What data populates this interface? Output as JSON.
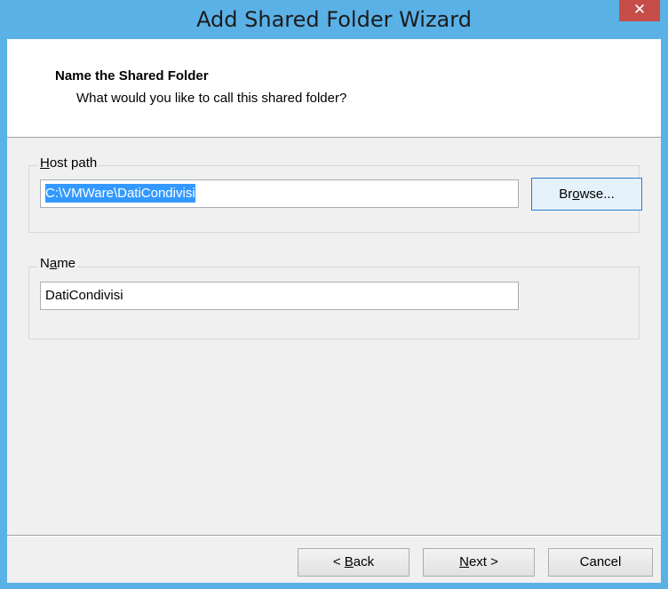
{
  "window": {
    "title": "Add Shared Folder Wizard",
    "close_glyph": "✕"
  },
  "header": {
    "title": "Name the Shared Folder",
    "subtitle": "What would you like to call this shared folder?"
  },
  "host_path": {
    "label_mnemonic": "H",
    "label_rest": "ost path",
    "value": "C:\\VMWare\\DatiCondivisi",
    "browse_pre": "Br",
    "browse_mnemonic": "o",
    "browse_post": "wse..."
  },
  "name": {
    "label_pre": "N",
    "label_mnemonic": "a",
    "label_post": "me",
    "value": "DatiCondivisi"
  },
  "buttons": {
    "back_pre": "< ",
    "back_mnemonic": "B",
    "back_post": "ack",
    "next_mnemonic": "N",
    "next_post": "ext >",
    "cancel": "Cancel"
  },
  "colors": {
    "titlebar": "#5ab1e6",
    "close_button": "#c74d48",
    "selection": "#3399ff",
    "dialog_bg": "#f0f0f0"
  }
}
